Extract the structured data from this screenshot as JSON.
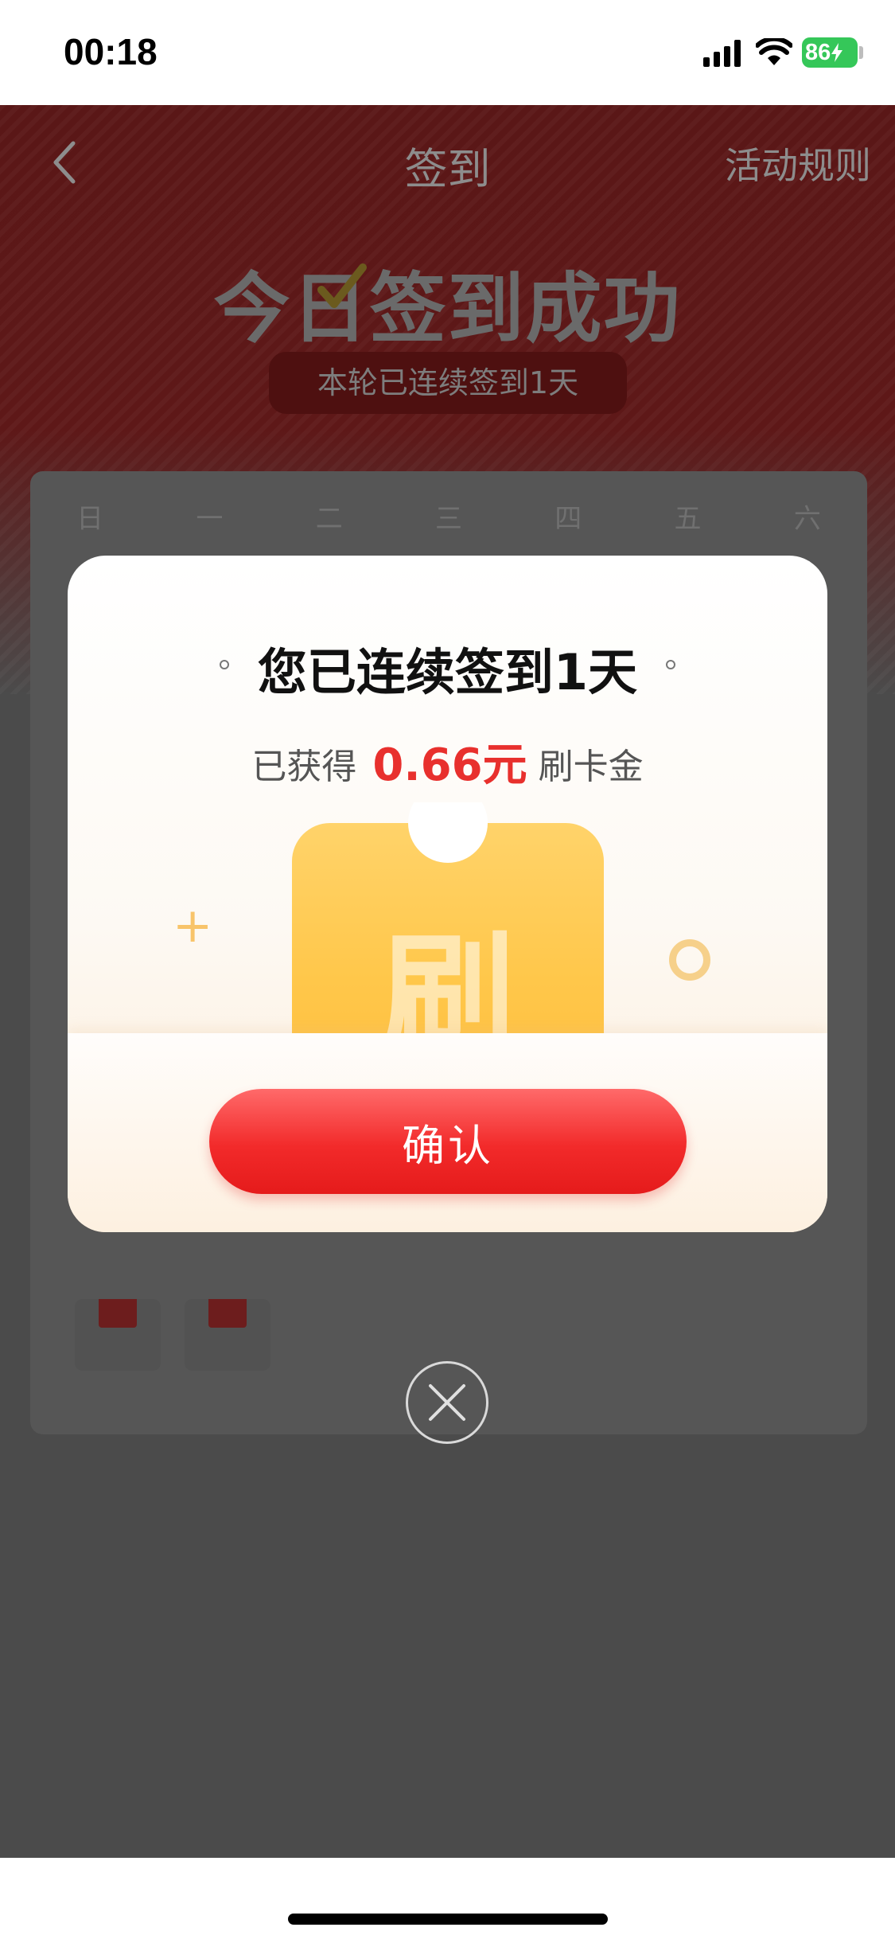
{
  "status_bar": {
    "time": "00:18",
    "battery": "86"
  },
  "nav": {
    "title": "签到",
    "rules_link": "活动规则"
  },
  "hero": {
    "title": "今日签到成功",
    "streak_text": "本轮已连续签到1天"
  },
  "calendar": {
    "weekdays": [
      "日",
      "一",
      "二",
      "三",
      "四",
      "五",
      "六"
    ]
  },
  "modal": {
    "title": "您已连续签到1天",
    "earned_prefix": "已获得",
    "amount": "0.66元",
    "earned_suffix": "刷卡金",
    "ticket_char": "刷",
    "confirm_label": "确认"
  },
  "colors": {
    "accent_red": "#e8302d",
    "ticket_yellow": "#ffc74a",
    "overlay": "#4b4b4b"
  },
  "icons": [
    "back-chevron-icon",
    "checkbox-check-icon",
    "close-icon",
    "plus-sparkle-icon",
    "ring-sparkle-icon",
    "signal-icon",
    "wifi-icon",
    "battery-icon"
  ]
}
